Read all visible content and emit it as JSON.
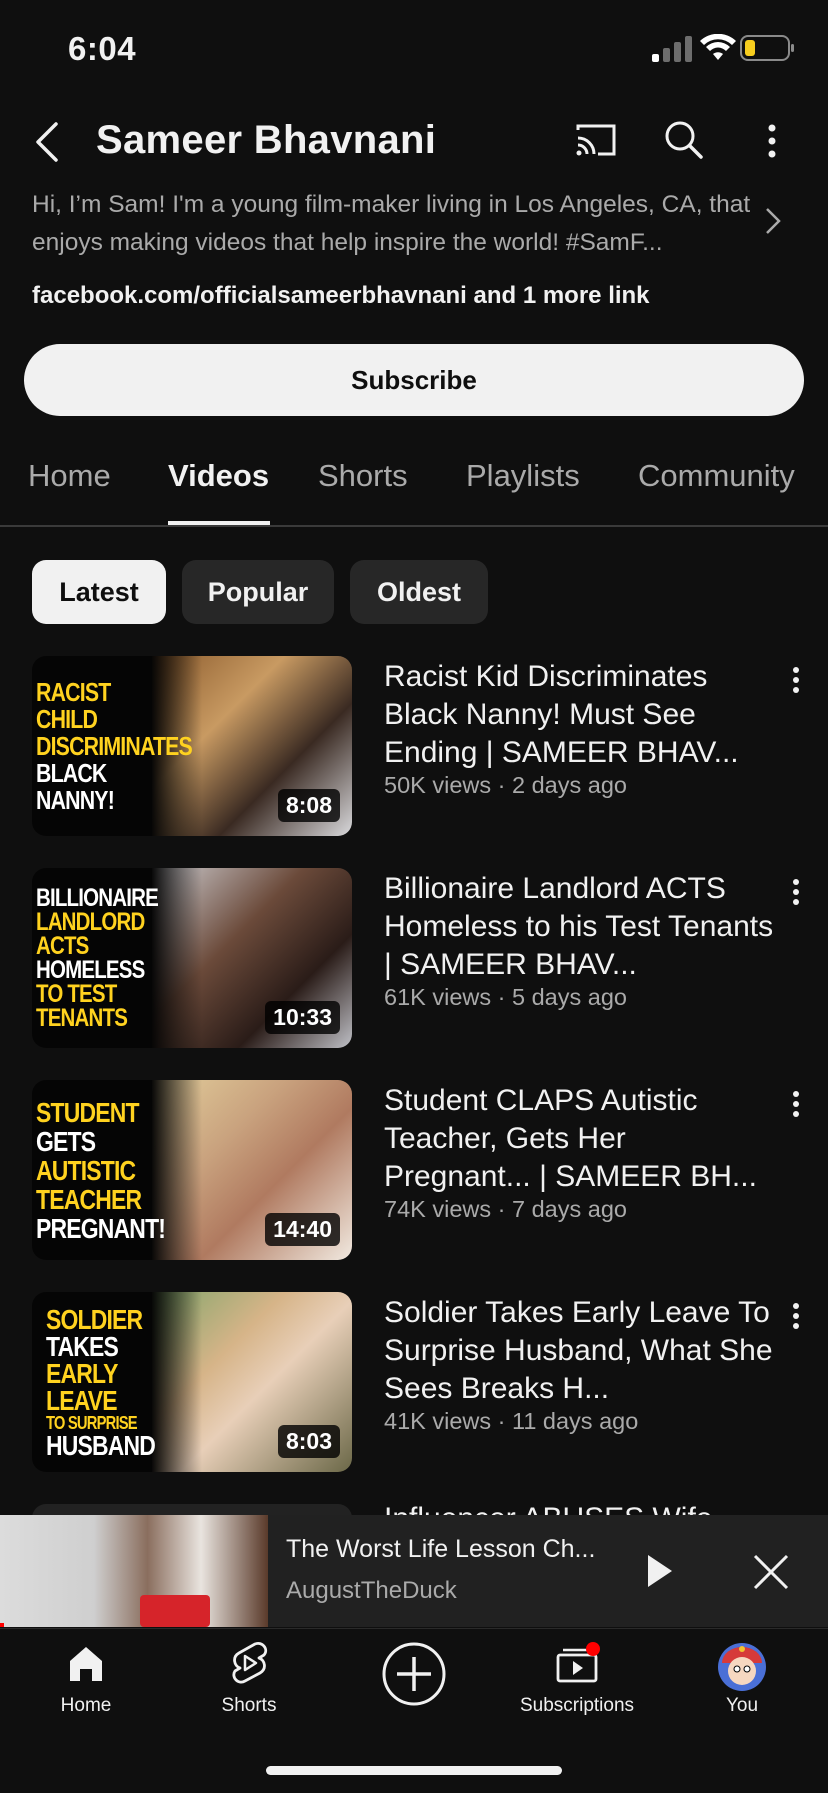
{
  "status_bar": {
    "time": "6:04"
  },
  "header": {
    "channel_name": "Sameer Bhavnani",
    "description": "Hi, I’m Sam! I'm a young film-maker living in Los Angeles, CA, that enjoys making videos that help inspire the world! #SamF...",
    "links": "facebook.com/officialsameerbhavnani and 1 more link",
    "subscribe_label": "Subscribe"
  },
  "tabs": [
    {
      "label": "Home"
    },
    {
      "label": "Videos"
    },
    {
      "label": "Shorts"
    },
    {
      "label": "Playlists"
    },
    {
      "label": "Community"
    }
  ],
  "active_tab": "Videos",
  "chips": [
    {
      "label": "Latest"
    },
    {
      "label": "Popular"
    },
    {
      "label": "Oldest"
    }
  ],
  "videos": [
    {
      "title": "Racist Kid Discriminates Black Nanny! Must See Ending | SAMEER BHAV...",
      "meta": "50K views · 2 days ago",
      "duration": "8:08",
      "thumb_lines": [
        {
          "text": "Racist Child"
        },
        {
          "text": "Discriminates"
        },
        {
          "text": "Black Nanny!"
        }
      ]
    },
    {
      "title": "Billionaire Landlord ACTS Homeless to his Test Tenants | SAMEER BHAV...",
      "meta": "61K views · 5 days ago",
      "duration": "10:33",
      "thumb_lines": [
        {
          "text": "Billionaire"
        },
        {
          "text": "Landlord"
        },
        {
          "text": "Acts"
        },
        {
          "text": "Homeless"
        },
        {
          "text": "To Test"
        },
        {
          "text": "Tenants"
        }
      ]
    },
    {
      "title": "Student CLAPS Autistic Teacher, Gets Her Pregnant... | SAMEER BH...",
      "meta": "74K views · 7 days ago",
      "duration": "14:40",
      "thumb_lines": [
        {
          "text": "Student"
        },
        {
          "text": "Gets"
        },
        {
          "text": "Autistic"
        },
        {
          "text": "Teacher"
        },
        {
          "text": "Pregnant!"
        }
      ]
    },
    {
      "title": "Soldier Takes Early Leave To Surprise Husband, What She Sees Breaks H...",
      "meta": "41K views · 11 days ago",
      "duration": "8:03",
      "thumb_lines": [
        {
          "text": "Soldier"
        },
        {
          "text": "Takes"
        },
        {
          "text": "Early"
        },
        {
          "text": "Leave"
        },
        {
          "text": "To Surprise"
        },
        {
          "text": "Husband"
        }
      ]
    }
  ],
  "partial_video_title": "Influencer ABUSES Wife",
  "miniplayer": {
    "title": "The Worst Life Lesson Ch...",
    "channel": "AugustTheDuck"
  },
  "bottom_nav": [
    {
      "label": "Home",
      "icon": "home-icon"
    },
    {
      "label": "Shorts",
      "icon": "shorts-icon"
    },
    {
      "label": "",
      "icon": "create-icon"
    },
    {
      "label": "Subscriptions",
      "icon": "subscriptions-icon"
    },
    {
      "label": "You",
      "icon": "avatar"
    }
  ],
  "colors": {
    "background": "#0f0f0f",
    "accent_red": "#ff0000",
    "thumb_yellow": "#ffd21f"
  }
}
